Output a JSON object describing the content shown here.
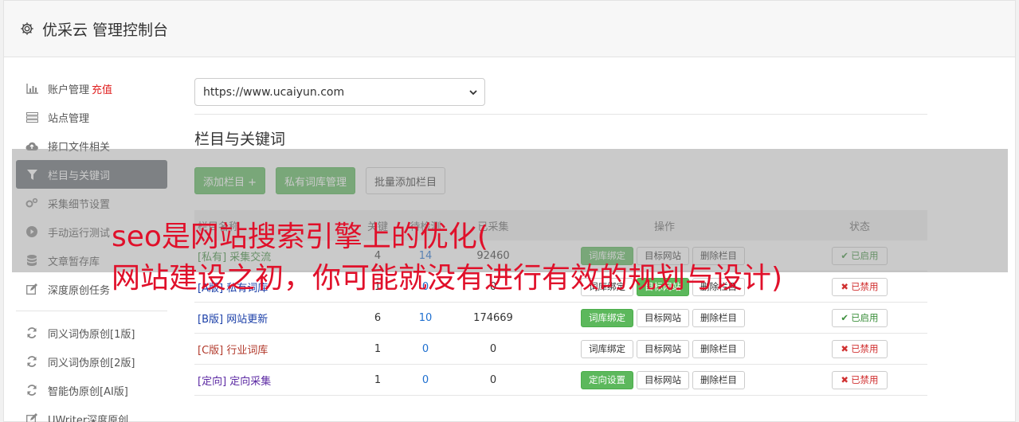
{
  "header": {
    "title": "优采云 管理控制台",
    "icon": "gear-icon"
  },
  "sidebar": {
    "items": [
      {
        "label": "账户管理",
        "extra": "充值",
        "icon": "bar-chart-icon"
      },
      {
        "label": "站点管理",
        "icon": "server-icon"
      },
      {
        "label": "接口文件相关",
        "icon": "cloud-upload-icon"
      },
      {
        "label": "栏目与关键词",
        "icon": "filter-icon",
        "active": true
      },
      {
        "label": "采集细节设置",
        "icon": "cogs-icon"
      },
      {
        "label": "手动运行测试",
        "icon": "play-circle-icon"
      },
      {
        "label": "文章暂存库",
        "icon": "database-icon"
      },
      {
        "label": "深度原创任务",
        "icon": "edit-icon"
      },
      {
        "label": "同义词伪原创[1版]",
        "icon": "refresh-icon"
      },
      {
        "label": "同义词伪原创[2版]",
        "icon": "refresh-icon"
      },
      {
        "label": "智能伪原创[AI版]",
        "icon": "refresh-icon"
      },
      {
        "label": "UWriter深度原创",
        "icon": "edit-icon"
      }
    ]
  },
  "main": {
    "site_select": {
      "value": "https://www.ucaiyun.com"
    },
    "section_title": "栏目与关键词",
    "buttons": {
      "add_column": "添加栏目 +",
      "private_lib": "私有词库管理",
      "batch_add": "批量添加栏目"
    },
    "table": {
      "headers": {
        "name": "栏目名称",
        "col_a": "关键",
        "col_b": "待检测",
        "col_c": "已采集",
        "ops": "操作",
        "status": "状态"
      },
      "rows": [
        {
          "tag": "[私有]",
          "name": "采集交流",
          "a": "4",
          "b": "14",
          "c": "92460",
          "op1": "词库绑定",
          "op2": "目标网站",
          "op3": "删除栏目",
          "status": "已启用"
        },
        {
          "tag": "[A版]",
          "name": "私有词库",
          "a": "1",
          "b": "0",
          "c": "0",
          "op1": "词库绑定",
          "op2": "目标网站",
          "op3": "删除栏目",
          "status": "已禁用"
        },
        {
          "tag": "[B版]",
          "name": "网站更新",
          "a": "6",
          "b": "10",
          "c": "174669",
          "op1": "词库绑定",
          "op2": "目标网站",
          "op3": "删除栏目",
          "status": "已启用"
        },
        {
          "tag": "[C版]",
          "name": "行业词库",
          "a": "1",
          "b": "0",
          "c": "0",
          "op1": "词库绑定",
          "op2": "目标网站",
          "op3": "删除栏目",
          "status": "已禁用"
        },
        {
          "tag": "[定向]",
          "name": "定向采集",
          "a": "1",
          "b": "0",
          "c": "0",
          "op1": "定向设置",
          "op2": "目标网站",
          "op3": "删除栏目",
          "status": "已禁用"
        }
      ]
    }
  },
  "overlay": {
    "line1": "seo是网站搜索引擎上的优化(",
    "line2": "网站建设之初，你可能就没有进行有效的规划与设计)"
  }
}
